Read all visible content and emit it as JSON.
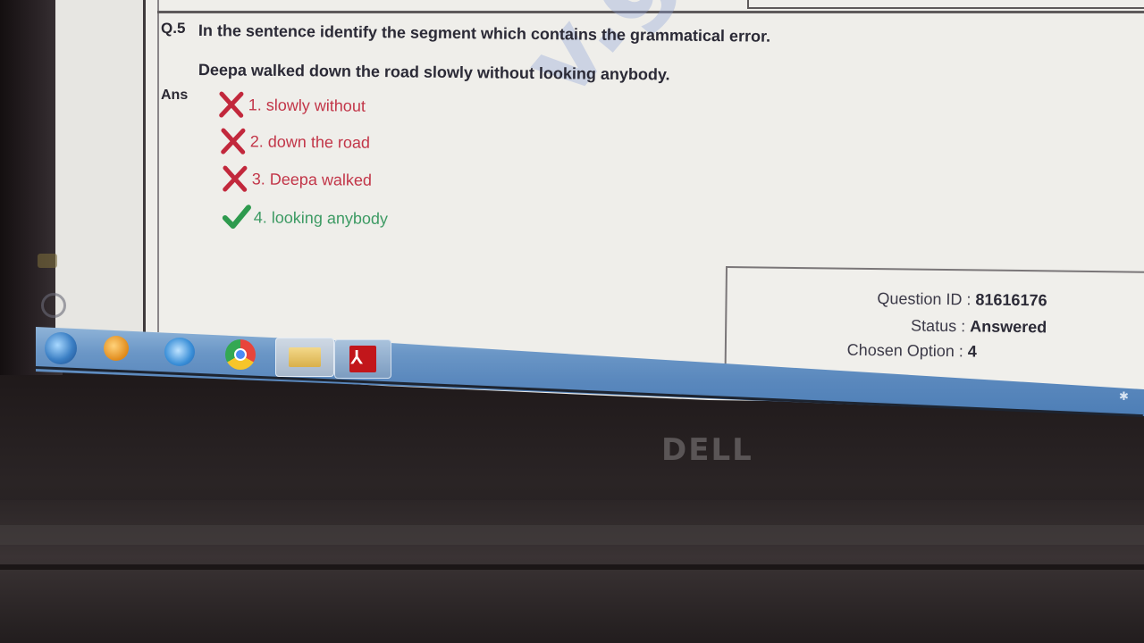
{
  "question": {
    "number": "Q.5",
    "text": "In the sentence identify the segment which contains the grammatical error.",
    "sentence": "Deepa walked down the road slowly without looking anybody.",
    "answer_label": "Ans",
    "options": [
      {
        "label": "1. slowly without",
        "status": "wrong",
        "icon": "cross-icon"
      },
      {
        "label": "2. down the road",
        "status": "wrong",
        "icon": "cross-icon"
      },
      {
        "label": "3. Deepa walked",
        "status": "wrong",
        "icon": "cross-icon"
      },
      {
        "label": "4. looking anybody",
        "status": "correct",
        "icon": "check-icon"
      }
    ]
  },
  "info": {
    "question_id_label": "Question ID :",
    "question_id": "81616176",
    "status_label": "Status :",
    "status": "Answered",
    "chosen_option_label": "Chosen Option :",
    "chosen_option": "4"
  },
  "watermark": "v.gmat",
  "brand": "DELL",
  "colors": {
    "wrong": "#c23548",
    "correct": "#3c9a63",
    "taskbar": "#5a88bd"
  },
  "taskbar_icons": [
    "start-orb-icon",
    "media-player-icon",
    "internet-explorer-icon",
    "chrome-icon",
    "file-explorer-icon",
    "acrobat-icon"
  ]
}
